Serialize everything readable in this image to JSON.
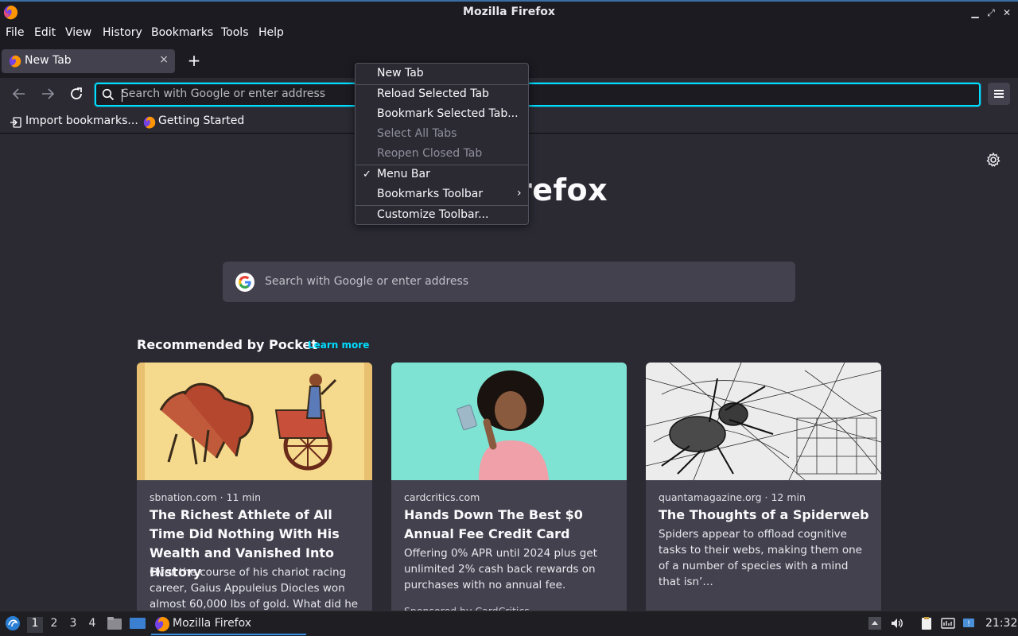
{
  "window": {
    "title": "Mozilla Firefox"
  },
  "menubar": {
    "file": "File",
    "edit": "Edit",
    "view": "View",
    "history": "History",
    "bookmarks": "Bookmarks",
    "tools": "Tools",
    "help": "Help"
  },
  "tab": {
    "label": "New Tab",
    "close": "×"
  },
  "newtab": "+",
  "urlbar": {
    "placeholder": "Search with Google or enter address"
  },
  "bookmarks": {
    "import": "Import bookmarks...",
    "getting_started": "Getting Started"
  },
  "brand": "refox",
  "search": {
    "placeholder": "Search with Google or enter address"
  },
  "pocket": {
    "heading": "Recommended by Pocket",
    "learn_more": "Learn more",
    "cards": [
      {
        "source": "sbnation.com · 11 min",
        "title": "The Richest Athlete of All Time Did Nothing With His Wealth and Vanished Into History",
        "excerpt": "Over the course of his chariot racing career, Gaius Appuleius Diocles won almost 60,000 lbs of gold. What did he …"
      },
      {
        "source": "cardcritics.com",
        "title": "Hands Down The Best $0 Annual Fee Credit Card",
        "excerpt": "Offering 0% APR until 2024 plus get unlimited 2% cash back rewards on purchases with no annual fee.",
        "sponsored": "Sponsored by CardCritics"
      },
      {
        "source": "quantamagazine.org · 12 min",
        "title": "The Thoughts of a Spiderweb",
        "excerpt": "Spiders appear to offload cognitive tasks to their webs, making them one of a number of species with a mind that isn’…"
      }
    ]
  },
  "context_menu": {
    "new_tab": "New Tab",
    "reload_selected": "Reload Selected Tab",
    "bookmark_selected": "Bookmark Selected Tab...",
    "select_all": "Select All Tabs",
    "reopen_closed": "Reopen Closed Tab",
    "menu_bar": "Menu Bar",
    "bookmarks_toolbar": "Bookmarks Toolbar",
    "customize": "Customize Toolbar...",
    "check": "✓",
    "arrow": "›"
  },
  "taskbar": {
    "workspaces": [
      "1",
      "2",
      "3",
      "4"
    ],
    "app_label": "Mozilla Firefox",
    "clock": "21:32"
  },
  "colors": {
    "accent": "#00ddff",
    "bg": "#2b2a33",
    "card": "#42414d"
  }
}
